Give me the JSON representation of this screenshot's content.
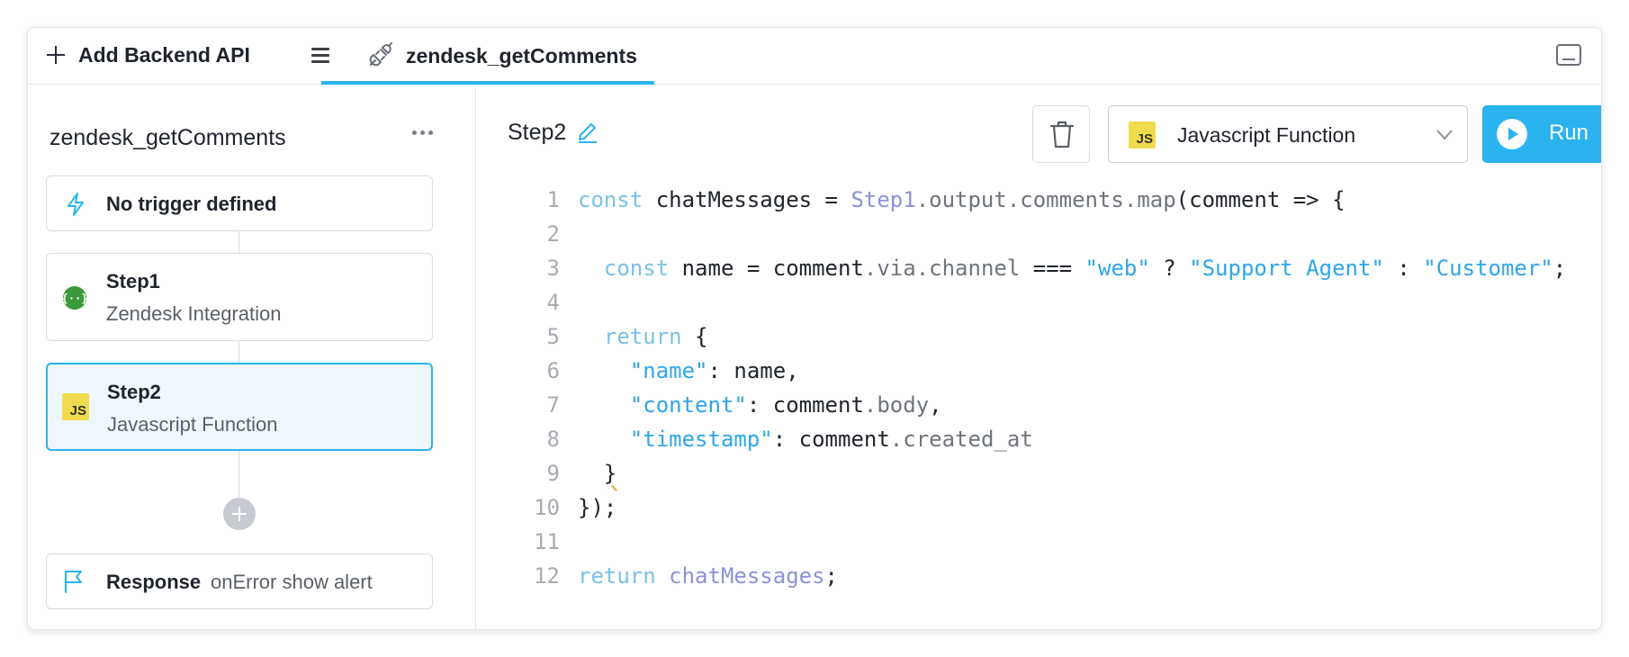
{
  "topbar": {
    "add_label": "Add Backend API",
    "active_tab": "zendesk_getComments"
  },
  "sidebar": {
    "title": "zendesk_getComments",
    "trigger": "No trigger defined",
    "steps": [
      {
        "name": "Step1",
        "sub": "Zendesk Integration"
      },
      {
        "name": "Step2",
        "sub": "Javascript Function"
      }
    ],
    "response": {
      "name": "Response",
      "sub": "onError show alert"
    }
  },
  "editor": {
    "step_title": "Step2",
    "type_label": "Javascript Function",
    "js_badge": "JS",
    "run_label": "Run"
  },
  "code": {
    "l1": [
      "1",
      "const",
      " chatMessages = ",
      "Step1",
      ".output.comments.map",
      "(comment => {"
    ],
    "l2": [
      "2"
    ],
    "l3": [
      "3",
      "  const",
      " name = comment",
      ".via.channel",
      " === ",
      "\"web\"",
      " ? ",
      "\"Support Agent\"",
      " : ",
      "\"Customer\"",
      ";"
    ],
    "l4": [
      "4"
    ],
    "l5": [
      "5",
      "  return",
      " {"
    ],
    "l6": [
      "6",
      "    \"name\"",
      ": name,"
    ],
    "l7": [
      "7",
      "    \"content\"",
      ": comment",
      ".body",
      ","
    ],
    "l8": [
      "8",
      "    \"timestamp\"",
      ": comment",
      ".created_at"
    ],
    "l9": [
      "9",
      "  ",
      "}"
    ],
    "l10": [
      "10",
      "});"
    ],
    "l11": [
      "11"
    ],
    "l12": [
      "12",
      "return",
      " ",
      "chatMessages",
      ";"
    ]
  },
  "colors": {
    "accent": "#2bb3f0",
    "js_yellow": "#f0db4f",
    "step1_green": "#3c9a3a"
  },
  "icons": [
    "plus-icon",
    "hamburger-icon",
    "plug-icon",
    "panel-toggle-icon",
    "more-icon",
    "lightning-icon",
    "integration-icon",
    "js-icon",
    "flag-icon",
    "pencil-icon",
    "trash-icon",
    "chevron-down-icon",
    "play-icon"
  ]
}
